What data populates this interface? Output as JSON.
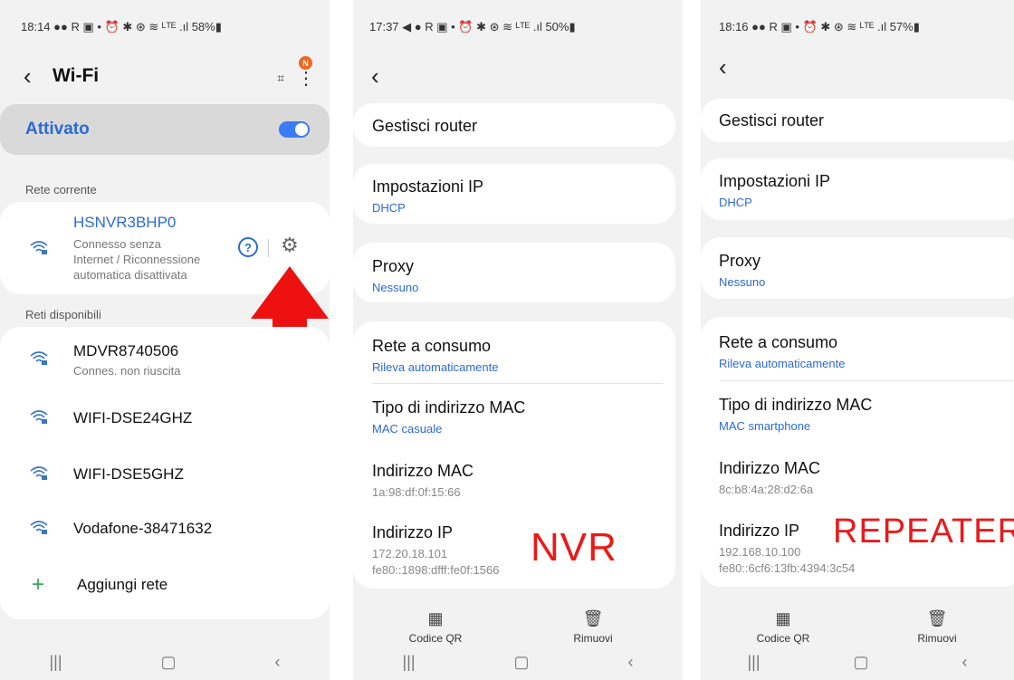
{
  "panel1": {
    "status": "18:14 ●● R ▣ •  ⏰ ✱ ⊛ ≋ ᴸᵀᴱ .ıl 58%▮",
    "title": "Wi-Fi",
    "badge": "N",
    "toggle_label": "Attivato",
    "section_current": "Rete corrente",
    "current_network": {
      "name": "HSNVR3BHP0",
      "sub1": "Connesso senza",
      "sub2": "Internet / Riconnessione",
      "sub3": "automatica disattivata"
    },
    "section_available": "Reti disponibili",
    "networks": [
      {
        "name": "MDVR8740506",
        "sub": "Connes. non riuscita"
      },
      {
        "name": "WIFI-DSE24GHZ"
      },
      {
        "name": "WIFI-DSE5GHZ"
      },
      {
        "name": "Vodafone-38471632"
      }
    ],
    "add_network": "Aggiungi rete"
  },
  "panel2": {
    "status": "17:37 ◀ ● R ▣ •  ⏰ ✱ ⊛ ≋ ᴸᵀᴱ .ıl 50%▮",
    "manage_router": "Gestisci router",
    "ip_settings": {
      "label": "Impostazioni IP",
      "value": "DHCP"
    },
    "proxy": {
      "label": "Proxy",
      "value": "Nessuno"
    },
    "metered": {
      "label": "Rete a consumo",
      "value": "Rileva automaticamente"
    },
    "mac_type": {
      "label": "Tipo di indirizzo MAC",
      "value": "MAC casuale"
    },
    "mac_address": {
      "label": "Indirizzo MAC",
      "value": "1a:98:df:0f:15:66"
    },
    "ip_address": {
      "label": "Indirizzo IP",
      "ipv4": "172.20.18.101",
      "ipv6": "fe80::1898:dfff:fe0f:1566"
    },
    "overlay_label": "NVR",
    "qr_label": "Codice QR",
    "remove_label": "Rimuovi"
  },
  "panel3": {
    "status": "18:16 ●● R ▣ •  ⏰ ✱ ⊛ ≋ ᴸᵀᴱ .ıl 57%▮",
    "manage_router": "Gestisci router",
    "ip_settings": {
      "label": "Impostazioni IP",
      "value": "DHCP"
    },
    "proxy": {
      "label": "Proxy",
      "value": "Nessuno"
    },
    "metered": {
      "label": "Rete a consumo",
      "value": "Rileva automaticamente"
    },
    "mac_type": {
      "label": "Tipo di indirizzo MAC",
      "value": "MAC smartphone"
    },
    "mac_address": {
      "label": "Indirizzo MAC",
      "value": "8c:b8:4a:28:d2:6a"
    },
    "ip_address": {
      "label": "Indirizzo IP",
      "ipv4": "192.168.10.100",
      "ipv6": "fe80::6cf6:13fb:4394:3c54"
    },
    "overlay_label": "REPEATER",
    "qr_label": "Codice QR",
    "remove_label": "Rimuovi"
  },
  "icons": {
    "back": "chevron-left-icon",
    "wifi": "wifi-lock-icon",
    "gear": "gear-icon",
    "help": "help-icon",
    "qr": "qr-code-icon",
    "trash": "trash-icon"
  },
  "colors": {
    "accent": "#2b6ad6",
    "overlay": "#e81a1a",
    "toggle": "#3b7bf5",
    "arrow": "#ee1111"
  }
}
